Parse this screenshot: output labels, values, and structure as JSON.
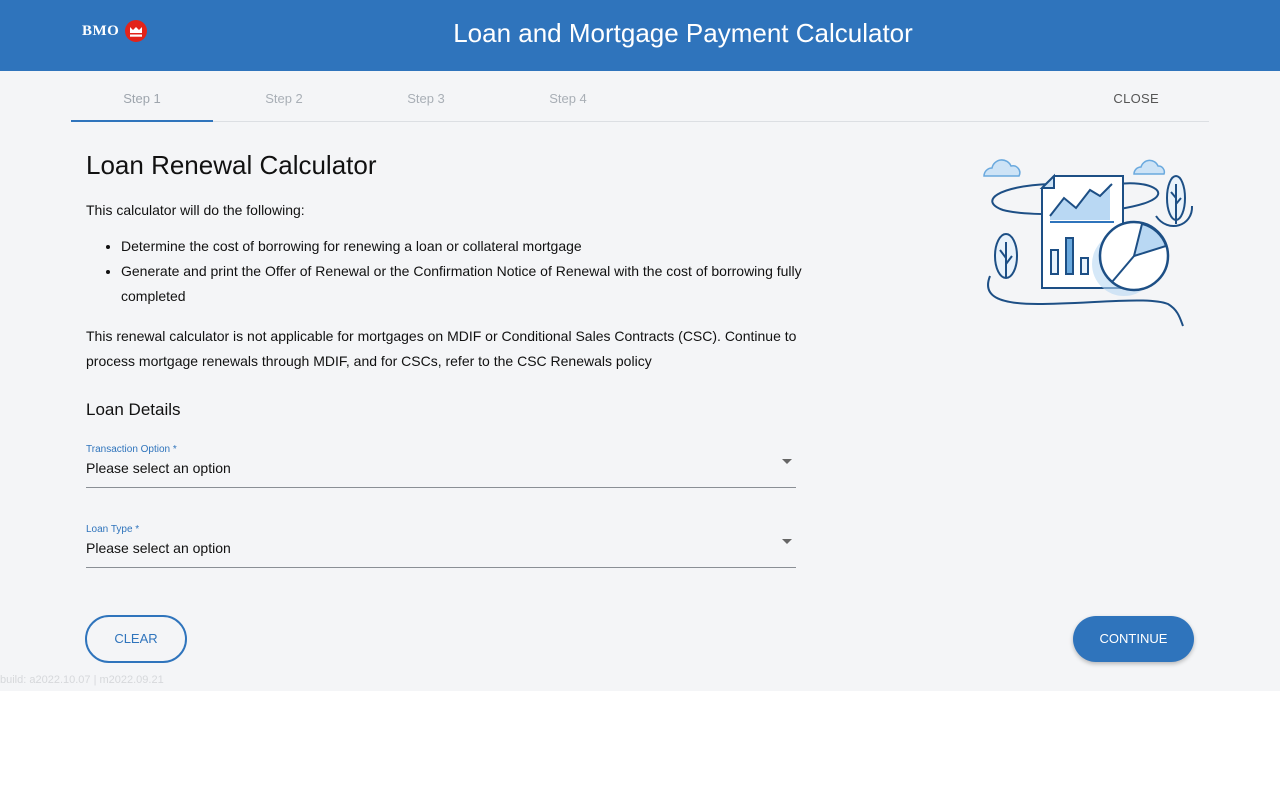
{
  "header": {
    "logo_text": "BMO",
    "title": "Loan and Mortgage Payment Calculator"
  },
  "tabs": [
    {
      "label": "Step 1",
      "active": true
    },
    {
      "label": "Step 2",
      "active": false
    },
    {
      "label": "Step 3",
      "active": false
    },
    {
      "label": "Step 4",
      "active": false
    }
  ],
  "close_label": "CLOSE",
  "main": {
    "title": "Loan Renewal Calculator",
    "intro": "This calculator will do the following:",
    "bullets": [
      "Determine the cost of borrowing for renewing a loan or collateral mortgage",
      "Generate and print the Offer of Renewal or the Confirmation Notice of Renewal with the cost of borrowing fully completed"
    ],
    "note": "This renewal calculator is not applicable for mortgages on MDIF or Conditional Sales Contracts (CSC). Continue to process mortgage renewals through MDIF, and for CSCs, refer to the CSC Renewals policy"
  },
  "loan_details": {
    "heading": "Loan Details",
    "transaction_option": {
      "label": "Transaction Option *",
      "value": "Please select an option"
    },
    "loan_type": {
      "label": "Loan Type *",
      "value": "Please select an option"
    }
  },
  "buttons": {
    "clear": "CLEAR",
    "continue": "CONTINUE"
  },
  "build_info": "build: a2022.10.07 | m2022.09.21",
  "colors": {
    "brand_blue": "#2f74bc",
    "brand_red": "#e2231a",
    "page_bg": "#f4f5f7"
  }
}
